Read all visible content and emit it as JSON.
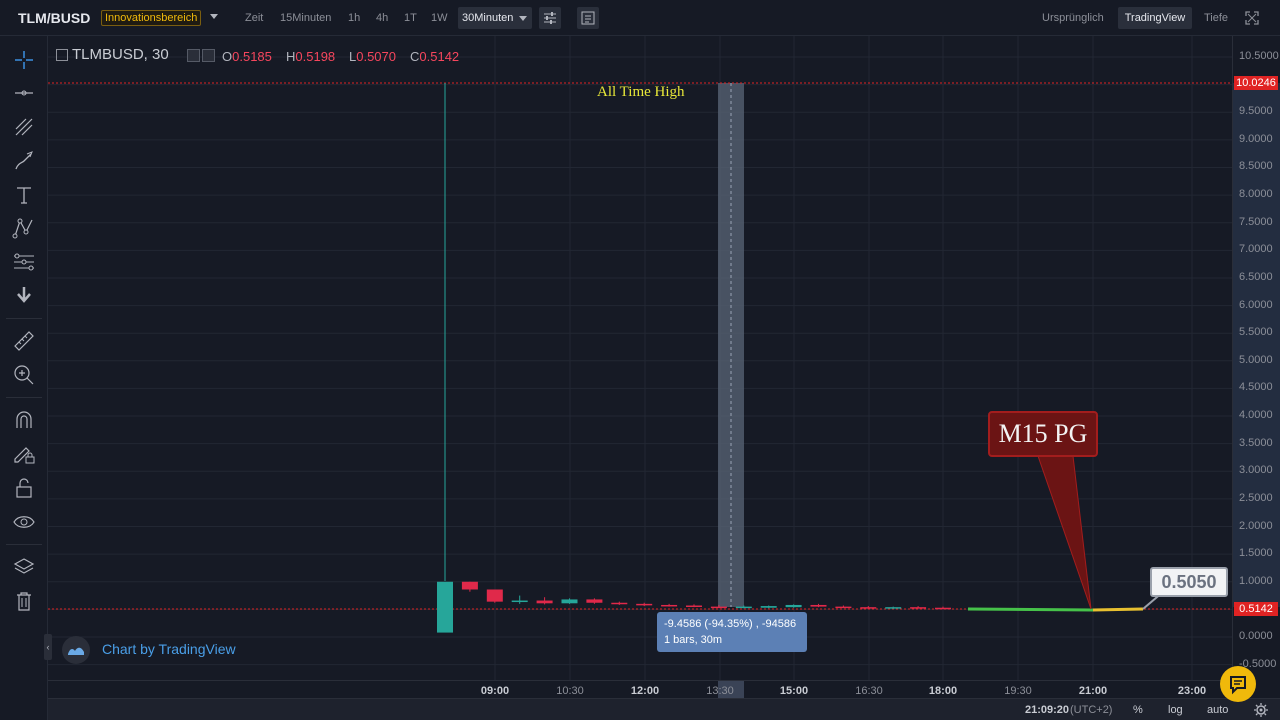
{
  "header": {
    "symbol": "TLM/BUSD",
    "badge": "Innovationsbereich",
    "intervals": [
      "Zeit",
      "15Minuten",
      "1h",
      "4h",
      "1T",
      "1W"
    ],
    "active_interval": "30Minuten",
    "views": {
      "original": "Ursprünglich",
      "tradingview": "TradingView",
      "depth": "Tiefe"
    }
  },
  "toolbar_icons": [
    "crosshair-icon",
    "horizontal-line-icon",
    "trend-line-tool-icon",
    "brush-icon",
    "text-tool-icon",
    "pattern-tool-icon",
    "fib-tool-icon",
    "arrow-down-icon",
    "ruler-icon",
    "zoom-in-icon",
    "magnet-icon",
    "lock-drawing-icon",
    "unlock-icon",
    "eye-icon",
    "layers-icon",
    "trash-icon"
  ],
  "legend": {
    "title": "TLMBUSD, 30",
    "o_label": "O",
    "o_value": "0.5185",
    "h_label": "H",
    "h_value": "0.5198",
    "l_label": "L",
    "l_value": "0.5070",
    "c_label": "C",
    "c_value": "0.5142"
  },
  "annotations": {
    "all_time_high": "All Time High",
    "measure_line1": "-9.4586 (-94.35%) , -94586",
    "measure_line2": "1 bars, 30m",
    "note": "M15 PG",
    "callout_price": "0.5050",
    "watermark": "Chart by TradingView"
  },
  "price_axis": {
    "labels": [
      "10.5000",
      "9.5000",
      "9.0000",
      "8.5000",
      "8.0000",
      "7.5000",
      "7.0000",
      "6.5000",
      "6.0000",
      "5.5000",
      "5.0000",
      "4.5000",
      "4.0000",
      "3.5000",
      "3.0000",
      "2.5000",
      "2.0000",
      "1.5000",
      "1.0000",
      "0.0000",
      "-0.5000"
    ],
    "ath_tag": "10.0246",
    "last_tag": "0.5142"
  },
  "time_axis": {
    "labels": [
      {
        "text": "09:00",
        "bold": true
      },
      {
        "text": "10:30",
        "bold": false
      },
      {
        "text": "12:00",
        "bold": true
      },
      {
        "text": "13:30",
        "bold": false
      },
      {
        "text": "15:00",
        "bold": true
      },
      {
        "text": "16:30",
        "bold": false
      },
      {
        "text": "18:00",
        "bold": true
      },
      {
        "text": "19:30",
        "bold": false
      },
      {
        "text": "21:00",
        "bold": true
      },
      {
        "text": "23:00",
        "bold": true
      }
    ]
  },
  "status": {
    "clock": "21:09:20",
    "tz": "(UTC+2)",
    "percent": "%",
    "log": "log",
    "auto": "auto"
  },
  "chart_data": {
    "type": "candlestick",
    "ylim": [
      -0.5,
      10.5
    ],
    "ath_price": 10.0246,
    "last_price": 0.5142,
    "candles": [
      {
        "t": "08:00",
        "o": 0.08,
        "h": 10.0246,
        "l": 0.08,
        "c": 1.0
      },
      {
        "t": "08:30",
        "o": 1.0,
        "h": 1.0,
        "l": 0.82,
        "c": 0.86
      },
      {
        "t": "09:00",
        "o": 0.86,
        "h": 0.86,
        "l": 0.62,
        "c": 0.64
      },
      {
        "t": "09:30",
        "o": 0.64,
        "h": 0.75,
        "l": 0.6,
        "c": 0.66
      },
      {
        "t": "10:00",
        "o": 0.66,
        "h": 0.72,
        "l": 0.59,
        "c": 0.61
      },
      {
        "t": "10:30",
        "o": 0.61,
        "h": 0.7,
        "l": 0.6,
        "c": 0.68
      },
      {
        "t": "11:00",
        "o": 0.68,
        "h": 0.7,
        "l": 0.6,
        "c": 0.62
      },
      {
        "t": "11:30",
        "o": 0.62,
        "h": 0.64,
        "l": 0.58,
        "c": 0.6
      },
      {
        "t": "12:00",
        "o": 0.6,
        "h": 0.62,
        "l": 0.56,
        "c": 0.58
      },
      {
        "t": "12:30",
        "o": 0.58,
        "h": 0.6,
        "l": 0.55,
        "c": 0.57
      },
      {
        "t": "13:00",
        "o": 0.57,
        "h": 0.59,
        "l": 0.54,
        "c": 0.55
      },
      {
        "t": "13:30",
        "o": 0.55,
        "h": 0.58,
        "l": 0.53,
        "c": 0.54
      },
      {
        "t": "14:00",
        "o": 0.54,
        "h": 0.57,
        "l": 0.52,
        "c": 0.55
      },
      {
        "t": "14:30",
        "o": 0.53,
        "h": 0.57,
        "l": 0.52,
        "c": 0.56
      },
      {
        "t": "15:00",
        "o": 0.54,
        "h": 0.59,
        "l": 0.53,
        "c": 0.58
      },
      {
        "t": "15:30",
        "o": 0.58,
        "h": 0.6,
        "l": 0.54,
        "c": 0.55
      },
      {
        "t": "16:00",
        "o": 0.55,
        "h": 0.57,
        "l": 0.53,
        "c": 0.54
      },
      {
        "t": "16:30",
        "o": 0.54,
        "h": 0.56,
        "l": 0.52,
        "c": 0.53
      },
      {
        "t": "17:00",
        "o": 0.52,
        "h": 0.55,
        "l": 0.51,
        "c": 0.54
      },
      {
        "t": "17:30",
        "o": 0.54,
        "h": 0.56,
        "l": 0.52,
        "c": 0.53
      },
      {
        "t": "18:00",
        "o": 0.53,
        "h": 0.55,
        "l": 0.51,
        "c": 0.52
      }
    ]
  }
}
